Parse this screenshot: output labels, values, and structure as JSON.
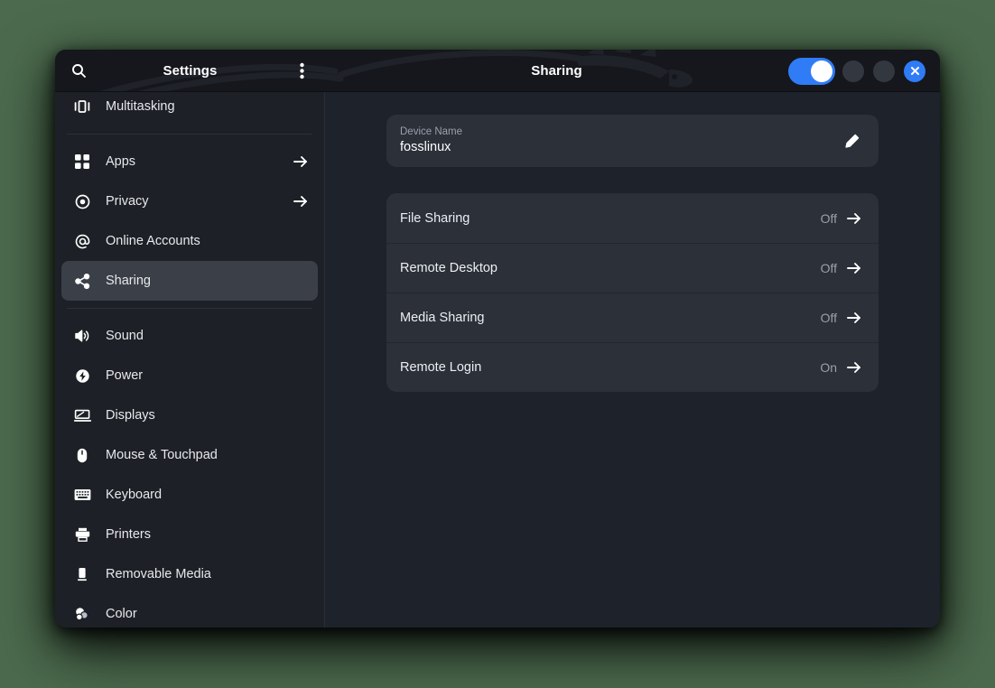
{
  "desktop": {
    "background_color": "#4c6b4e"
  },
  "window": {
    "headerbar": {
      "sidebar_title": "Settings",
      "content_title": "Sharing",
      "search_icon": "search-icon",
      "menu_icon": "menu-three-dots-icon",
      "toggle": {
        "name": "header-toggle-switch",
        "state": "on",
        "accent_color": "#2f7cf6"
      },
      "window_controls": [
        {
          "name": "minimize-button",
          "glyph": ""
        },
        {
          "name": "maximize-button",
          "glyph": ""
        },
        {
          "name": "close-button",
          "glyph": "✕",
          "color": "#2f7cf6"
        }
      ],
      "watermark": "kali-dragon-artwork"
    },
    "sidebar": {
      "items": [
        {
          "label": "Multitasking",
          "icon": "multitasking-icon",
          "arrow": false,
          "selected": false
        },
        {
          "label": "Apps",
          "icon": "apps-grid-icon",
          "arrow": true,
          "selected": false
        },
        {
          "label": "Privacy",
          "icon": "privacy-shield-icon",
          "arrow": true,
          "selected": false
        },
        {
          "label": "Online Accounts",
          "icon": "at-sign-icon",
          "arrow": false,
          "selected": false
        },
        {
          "label": "Sharing",
          "icon": "share-nodes-icon",
          "arrow": false,
          "selected": true
        },
        {
          "label": "Sound",
          "icon": "speaker-icon",
          "arrow": false,
          "selected": false
        },
        {
          "label": "Power",
          "icon": "power-bolt-icon",
          "arrow": false,
          "selected": false
        },
        {
          "label": "Displays",
          "icon": "display-monitor-icon",
          "arrow": false,
          "selected": false
        },
        {
          "label": "Mouse & Touchpad",
          "icon": "mouse-icon",
          "arrow": false,
          "selected": false
        },
        {
          "label": "Keyboard",
          "icon": "keyboard-icon",
          "arrow": false,
          "selected": false
        },
        {
          "label": "Printers",
          "icon": "printer-icon",
          "arrow": false,
          "selected": false
        },
        {
          "label": "Removable Media",
          "icon": "removable-media-icon",
          "arrow": false,
          "selected": false
        },
        {
          "label": "Color",
          "icon": "color-profile-icon",
          "arrow": false,
          "selected": false
        }
      ]
    },
    "content": {
      "device": {
        "label": "Device Name",
        "value": "fosslinux",
        "edit_icon": "pencil-edit-icon"
      },
      "sharing_rows": [
        {
          "label": "File Sharing",
          "status": "Off"
        },
        {
          "label": "Remote Desktop",
          "status": "Off"
        },
        {
          "label": "Media Sharing",
          "status": "Off"
        },
        {
          "label": "Remote Login",
          "status": "On"
        }
      ]
    }
  }
}
